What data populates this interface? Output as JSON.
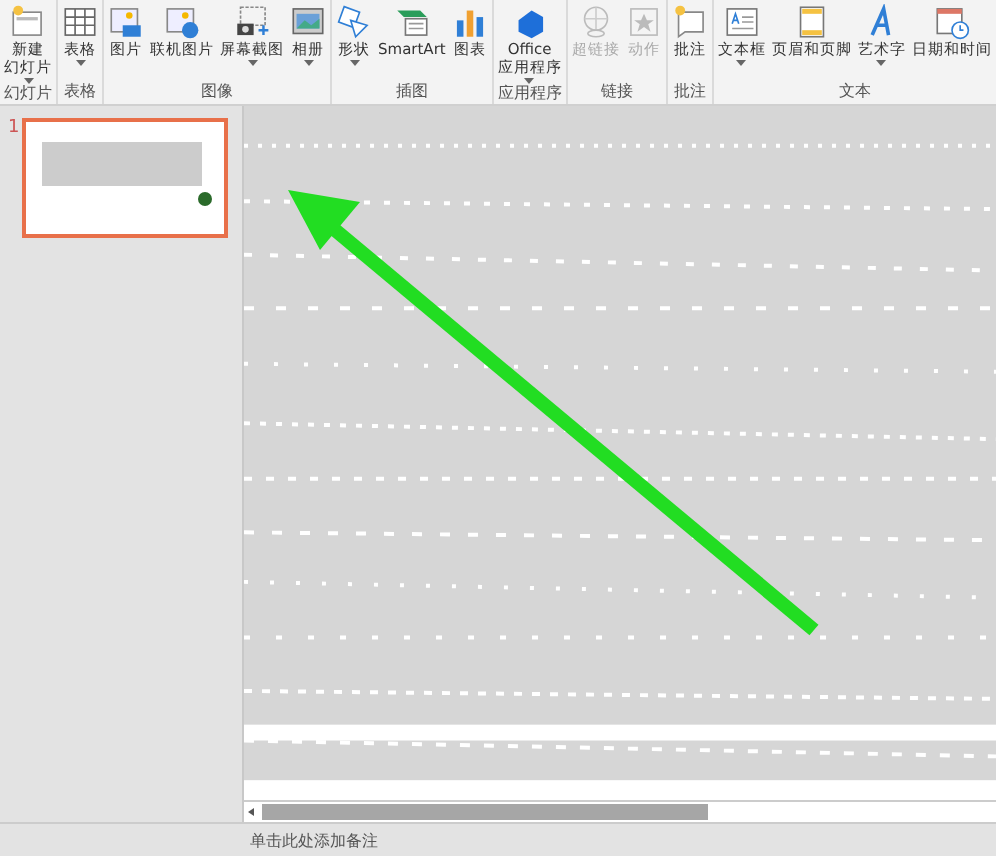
{
  "ribbon": {
    "groups": [
      {
        "label": "幻灯片",
        "buttons": [
          {
            "lines": [
              "新建",
              "幻灯片"
            ],
            "kind": "new-slide",
            "dropdown": true,
            "disabled": false
          }
        ]
      },
      {
        "label": "表格",
        "buttons": [
          {
            "lines": [
              "表格"
            ],
            "kind": "table",
            "dropdown": true,
            "disabled": false
          }
        ]
      },
      {
        "label": "图像",
        "buttons": [
          {
            "lines": [
              "图片"
            ],
            "kind": "picture",
            "dropdown": false,
            "disabled": false
          },
          {
            "lines": [
              "联机图片"
            ],
            "kind": "online-picture",
            "dropdown": false,
            "disabled": false
          },
          {
            "lines": [
              "屏幕截图"
            ],
            "kind": "screenshot",
            "dropdown": true,
            "disabled": false
          },
          {
            "lines": [
              "相册"
            ],
            "kind": "album",
            "dropdown": true,
            "disabled": false
          }
        ]
      },
      {
        "label": "插图",
        "buttons": [
          {
            "lines": [
              "形状"
            ],
            "kind": "shapes",
            "dropdown": true,
            "disabled": false
          },
          {
            "lines": [
              "SmartArt"
            ],
            "kind": "smartart",
            "dropdown": false,
            "disabled": false
          },
          {
            "lines": [
              "图表"
            ],
            "kind": "chart",
            "dropdown": false,
            "disabled": false
          }
        ]
      },
      {
        "label": "应用程序",
        "buttons": [
          {
            "lines": [
              "Office",
              "应用程序"
            ],
            "kind": "office",
            "dropdown": true,
            "disabled": false
          }
        ]
      },
      {
        "label": "链接",
        "buttons": [
          {
            "lines": [
              "超链接"
            ],
            "kind": "hyperlink",
            "dropdown": false,
            "disabled": true
          },
          {
            "lines": [
              "动作"
            ],
            "kind": "action",
            "dropdown": false,
            "disabled": true
          }
        ]
      },
      {
        "label": "批注",
        "buttons": [
          {
            "lines": [
              "批注"
            ],
            "kind": "comment",
            "dropdown": false,
            "disabled": false
          }
        ]
      },
      {
        "label": "文本",
        "buttons": [
          {
            "lines": [
              "文本框"
            ],
            "kind": "textbox",
            "dropdown": true,
            "disabled": false
          },
          {
            "lines": [
              "页眉和页脚"
            ],
            "kind": "header",
            "dropdown": false,
            "disabled": false
          },
          {
            "lines": [
              "艺术字"
            ],
            "kind": "wordart",
            "dropdown": true,
            "disabled": false
          },
          {
            "lines": [
              "日期和时间"
            ],
            "kind": "datetime",
            "dropdown": false,
            "disabled": false
          }
        ]
      }
    ]
  },
  "slides": [
    {
      "number": "1",
      "selected": true
    }
  ],
  "notes": {
    "placeholder": "单击此处添加备注"
  }
}
